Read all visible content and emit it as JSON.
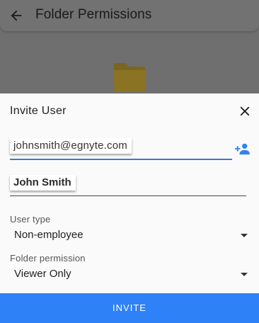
{
  "app_bar": {
    "title": "Folder Permissions",
    "back_icon": "arrow-back-icon"
  },
  "background": {
    "folder_icon": "folder-icon",
    "folder_color": "#f2c200"
  },
  "dialog": {
    "title": "Invite User",
    "close_icon": "close-icon",
    "email_value": "johnsmith@egnyte.com",
    "add_user_icon": "person-add-icon",
    "name_value": "John Smith",
    "user_type": {
      "label": "User type",
      "value": "Non-employee"
    },
    "folder_permission": {
      "label": "Folder permission",
      "value": "Viewer Only"
    },
    "invite_button": "INVITE",
    "accent_color": "#2f81f7"
  }
}
